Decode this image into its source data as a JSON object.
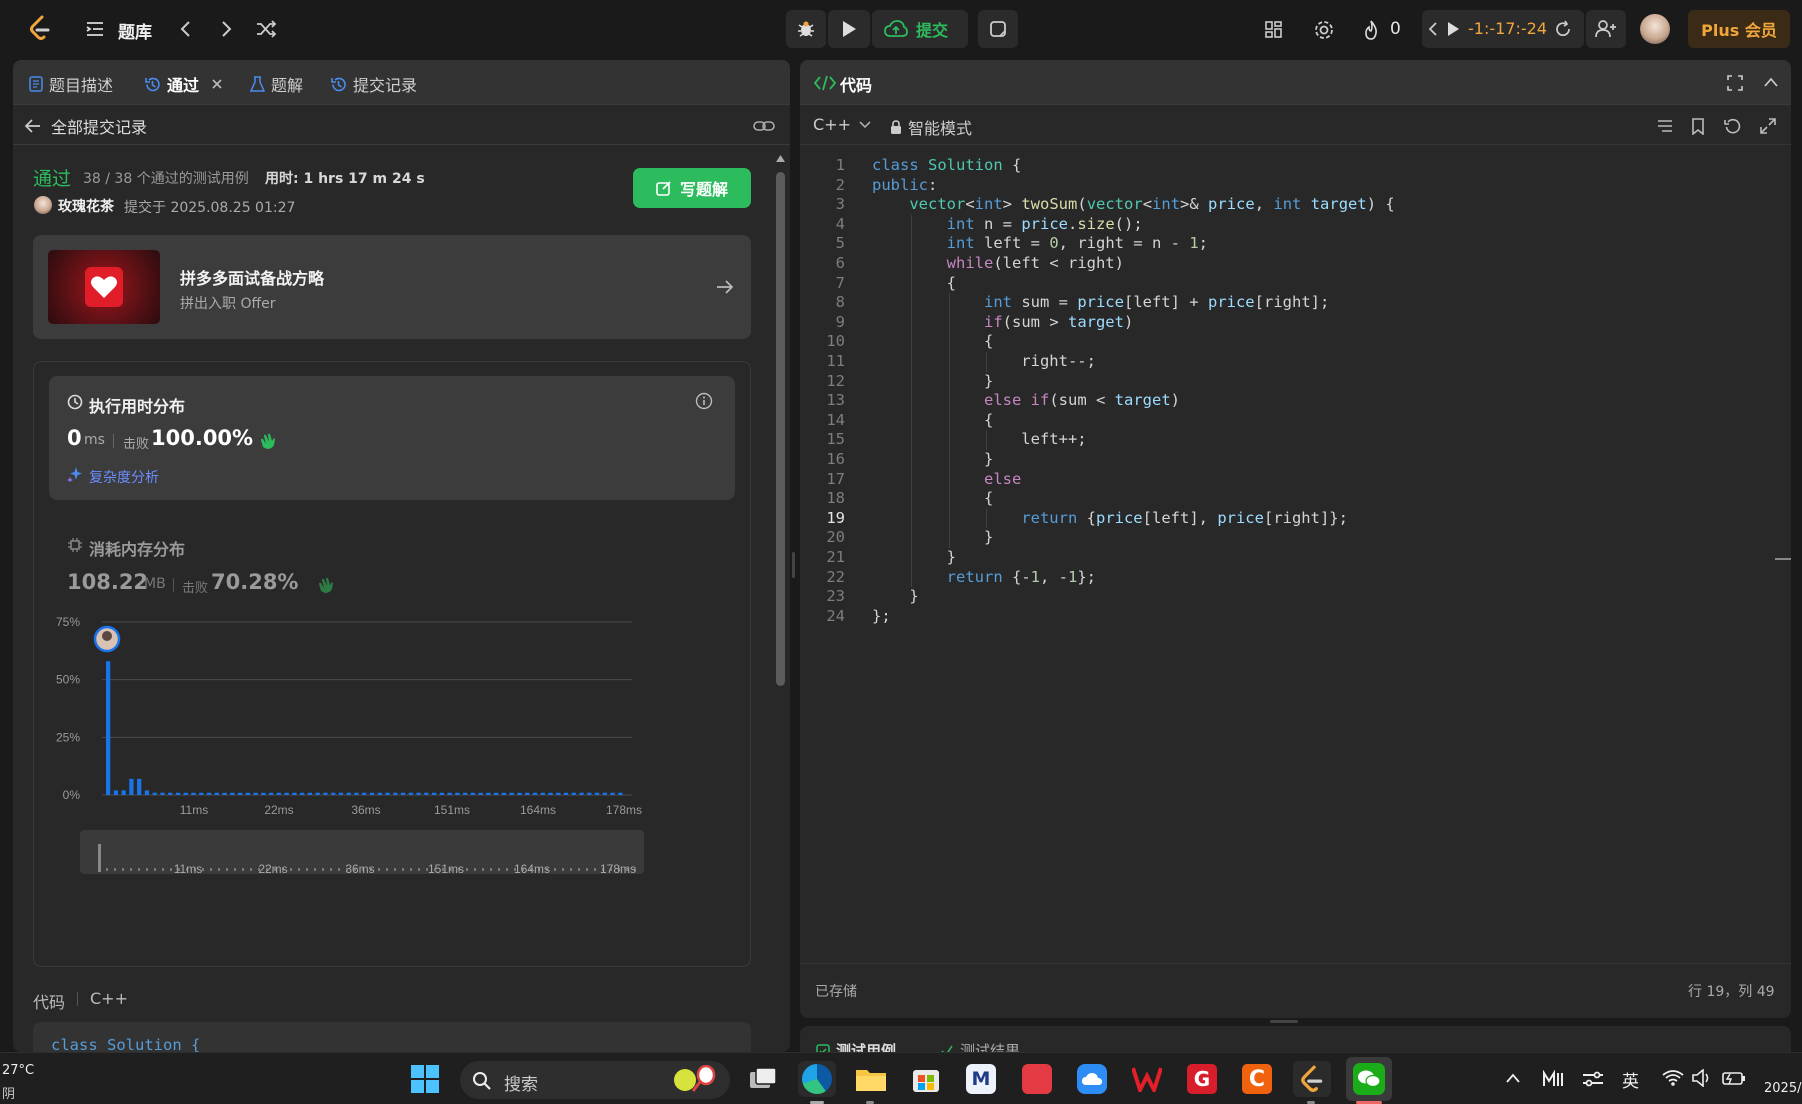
{
  "topbar": {
    "problem_bank": "题库",
    "submit": "提交",
    "streak": "0",
    "timer": "-1:-17:-24",
    "plus": "Plus 会员"
  },
  "left": {
    "tabs": [
      "题目描述",
      "通过",
      "题解",
      "提交记录"
    ],
    "back_label": "全部提交记录",
    "status": "通过",
    "testcases": "38 / 38 个通过的测试用例",
    "time_used": "用时: 1 hrs 17 m 24 s",
    "user": "玫瑰花茶",
    "submitted_at": "提交于 2025.08.25 01:27",
    "write_solution": "写题解",
    "promo_title": "拼多多面试备战方略",
    "promo_sub": "拼出入职 Offer",
    "runtime_title": "执行用时分布",
    "runtime_value": "0",
    "runtime_unit": "ms",
    "beats_label": "击败",
    "runtime_beats": "100.00%",
    "complexity": "复杂度分析",
    "memory_title": "消耗内存分布",
    "memory_value": "108.22",
    "memory_unit": "MB",
    "memory_beats": "70.28%",
    "code_label": "代码",
    "code_lang": "C++",
    "code_preview": "class Solution {"
  },
  "chart_data": {
    "type": "bar",
    "ylabel": "",
    "y_ticks": [
      "75%",
      "50%",
      "25%",
      "0%"
    ],
    "ylim": [
      0,
      75
    ],
    "x_ticks": [
      "11ms",
      "22ms",
      "36ms",
      "151ms",
      "164ms",
      "178ms"
    ],
    "values": [
      58,
      2,
      2,
      7,
      7,
      2,
      1,
      1,
      1,
      1,
      1,
      1,
      1,
      1,
      1,
      1,
      1,
      1,
      1,
      1,
      1,
      1,
      1,
      1,
      1,
      1,
      1,
      1,
      1,
      1,
      1,
      1,
      1,
      1,
      1,
      1,
      1,
      1,
      1,
      1,
      1,
      1,
      1,
      1,
      1,
      1,
      1,
      1,
      1,
      1,
      1,
      1,
      1,
      1,
      1,
      1,
      1,
      1,
      1,
      1,
      1,
      1,
      1,
      1,
      1,
      1,
      1
    ],
    "highlight_index": 0,
    "color": "#1a73e8"
  },
  "right": {
    "title": "代码",
    "lang": "C++",
    "mode": "智能模式",
    "saved": "已存储",
    "cursor": "行 19，列 49",
    "bottom_tabs": [
      "测试用例",
      "测试结果"
    ],
    "active_line": 19
  },
  "code_lines": [
    "class Solution {",
    "public:",
    "    vector<int> twoSum(vector<int>& price, int target) {",
    "        int n = price.size();",
    "        int left = 0, right = n - 1;",
    "        while(left < right)",
    "        {",
    "            int sum = price[left] + price[right];",
    "            if(sum > target)",
    "            {",
    "                right--;",
    "            }",
    "            else if(sum < target)",
    "            {",
    "                left++;",
    "            }",
    "            else",
    "            {",
    "                return {price[left], price[right]};",
    "            }",
    "        }",
    "        return {-1, -1};",
    "    }",
    "};"
  ],
  "taskbar": {
    "weather_temp": "27°C",
    "weather_desc": "阴",
    "search": "搜索",
    "ime": "英",
    "date": "2025/"
  }
}
